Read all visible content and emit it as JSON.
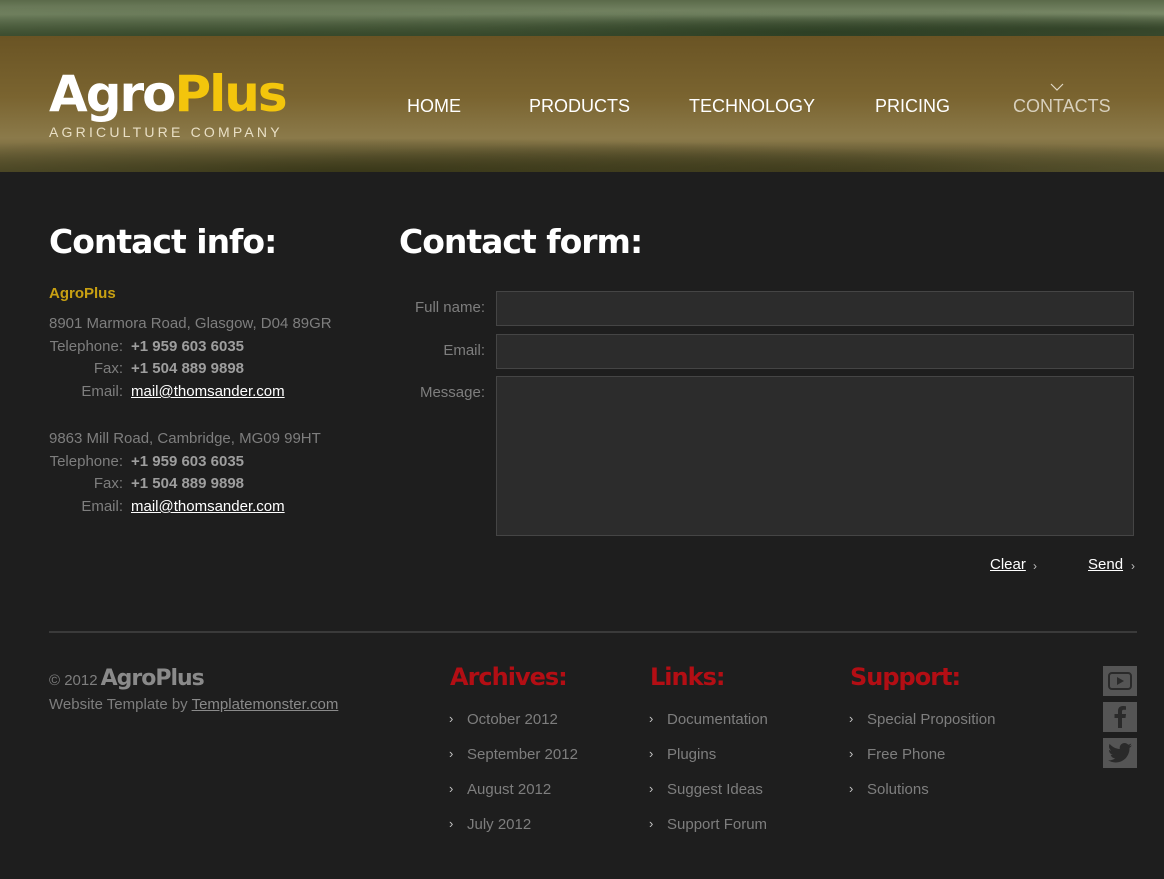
{
  "brand": {
    "name_part1": "Agro",
    "name_part2": "Plus",
    "tagline": "AGRICULTURE COMPANY"
  },
  "nav": {
    "items": [
      {
        "label": "HOME"
      },
      {
        "label": "PRODUCTS"
      },
      {
        "label": "TECHNOLOGY"
      },
      {
        "label": "PRICING"
      },
      {
        "label": "CONTACTS",
        "active": true
      }
    ]
  },
  "contact_info": {
    "title": "Contact info:",
    "company": "AgroPlus",
    "offices": [
      {
        "address": "8901 Marmora Road, Glasgow, D04 89GR",
        "telephone_label": "Telephone:",
        "telephone": "+1 959 603 6035",
        "fax_label": "Fax:",
        "fax": "+1 504 889 9898",
        "email_label": "Email:",
        "email": "mail@thomsander.com"
      },
      {
        "address": "9863 Mill Road, Cambridge, MG09 99HT",
        "telephone_label": "Telephone:",
        "telephone": "+1 959 603 6035",
        "fax_label": "Fax:",
        "fax": "+1 504 889 9898",
        "email_label": "Email:",
        "email": "mail@thomsander.com"
      }
    ]
  },
  "contact_form": {
    "title": "Contact form:",
    "full_name_label": "Full name:",
    "full_name_value": "",
    "email_label": "Email:",
    "email_value": "",
    "message_label": "Message:",
    "message_value": "",
    "clear_label": "Clear",
    "send_label": "Send"
  },
  "footer": {
    "copyright": "© 2012",
    "brand": "AgroPlus",
    "credit_prefix": "Website Template by",
    "credit_link": "Templatemonster.com",
    "archives": {
      "title": "Archives:",
      "items": [
        "October 2012",
        "September 2012",
        "August 2012",
        "July 2012"
      ]
    },
    "links": {
      "title": "Links:",
      "items": [
        "Documentation",
        "Plugins",
        "Suggest Ideas",
        "Support Forum"
      ]
    },
    "support": {
      "title": "Support:",
      "items": [
        "Special Proposition",
        "Free Phone",
        "Solutions"
      ]
    },
    "social": [
      "youtube-icon",
      "facebook-icon",
      "twitter-icon"
    ]
  },
  "colors": {
    "accent_yellow": "#f3c50c",
    "footer_heading_red": "#b30e14",
    "background": "#1e1e1e"
  }
}
